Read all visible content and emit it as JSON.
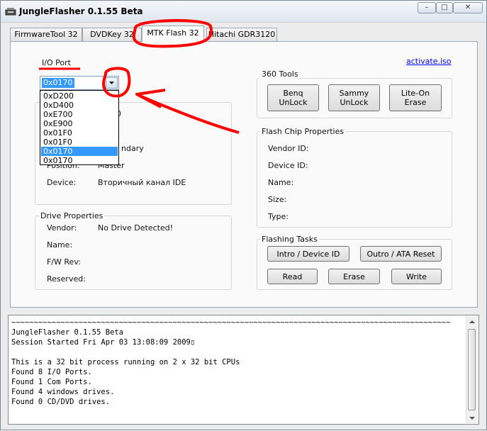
{
  "window": {
    "title": "JungleFlasher 0.1.55 Beta",
    "minimize_glyph": "–",
    "maximize_glyph": "□",
    "close_glyph": "✕"
  },
  "tabs": [
    {
      "label": "FirmwareTool 32",
      "active": false
    },
    {
      "label": "DVDKey 32",
      "active": false
    },
    {
      "label": "MTK Flash 32",
      "active": true
    },
    {
      "label": "Hitachi GDR3120",
      "active": false
    }
  ],
  "io_port": {
    "label": "I/O Port",
    "selected": "0x0170",
    "options": [
      "0xD200",
      "0xD400",
      "0xE700",
      "0xE900",
      "0x01F0",
      "0x01F0",
      "0x0170",
      "0x0170"
    ],
    "highlighted_index": 6
  },
  "device_group": {
    "rows": [
      {
        "label": "",
        "value": "0"
      },
      {
        "label": "",
        "value": ""
      },
      {
        "label": "",
        "value": "ndary"
      },
      {
        "label": "Position:",
        "value": "Master"
      },
      {
        "label": "Device:",
        "value": "Вторичный канал IDE"
      }
    ]
  },
  "drive_properties": {
    "title": "Drive Properties",
    "rows": [
      {
        "label": "Vendor:",
        "value": "No Drive Detected!"
      },
      {
        "label": "Name:",
        "value": ""
      },
      {
        "label": "F/W Rev:",
        "value": ""
      },
      {
        "label": "Reserved:",
        "value": ""
      }
    ]
  },
  "activate_link": "activate.iso",
  "tools_360": {
    "title": "360 Tools",
    "buttons": [
      "Benq\nUnLock",
      "Sammy\nUnLock",
      "Lite-On Erase"
    ]
  },
  "flash_chip": {
    "title": "Flash Chip Properties",
    "rows": [
      "Vendor ID:",
      "Device ID:",
      "Name:",
      "Size:",
      "Type:"
    ]
  },
  "flashing_tasks": {
    "title": "Flashing Tasks",
    "intro_label": "Intro / Device ID",
    "outro_label": "Outro / ATA Reset",
    "read_label": "Read",
    "erase_label": "Erase",
    "write_label": "Write"
  },
  "console_log": "~~~~~~~~~~~~~~~~~~~~~~~~~~~~~~~~~~~~~~~~~~~~~~~~~~~~~~~~~~~~~~~~~~~~~~~~~~~~~~~~~~~~~~~~~~~~~~~~~~\nJungleFlasher 0.1.55 Beta\nSession Started Fri Apr 03 13:08:09 2009▯\n\nThis is a 32 bit process running on 2 x 32 bit CPUs\nFound 8 I/O Ports.\nFound 1 Com Ports.\nFound 4 windows drives.\nFound 0 CD/DVD drives.",
  "annotation_color": "#ff0000"
}
